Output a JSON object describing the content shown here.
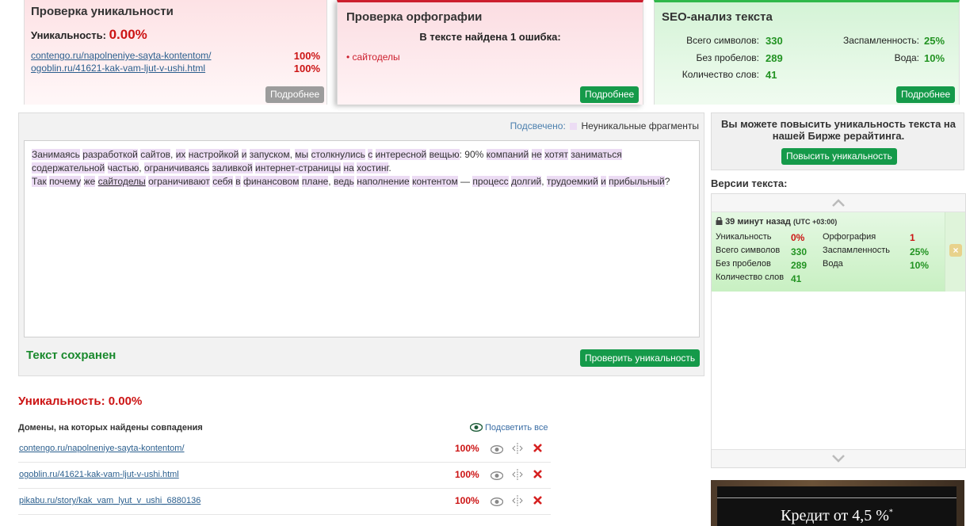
{
  "uniqueness_panel": {
    "title": "Проверка уникальности",
    "uniq_label": "Уникальность:",
    "uniq_value": "0.00%",
    "matches": [
      {
        "url": "contengo.ru/napolneniye-sayta-kontentom/",
        "pct": "100%"
      },
      {
        "url": "ogoblin.ru/41621-kak-vam-ljut-v-ushi.html",
        "pct": "100%"
      }
    ],
    "more_button": "Подробнее"
  },
  "spelling_panel": {
    "title": "Проверка орфографии",
    "summary": "В тексте найдена 1 ошибка:",
    "errors": [
      "сайтоделы"
    ],
    "more_button": "Подробнее"
  },
  "seo_panel": {
    "title": "SEO-анализ текста",
    "total_chars_label": "Всего символов:",
    "total_chars": "330",
    "no_spaces_label": "Без пробелов:",
    "no_spaces": "289",
    "word_count_label": "Количество слов:",
    "word_count": "41",
    "spam_label": "Заспамленность:",
    "spam": "25%",
    "water_label": "Вода:",
    "water": "10%",
    "more_button": "Подробнее"
  },
  "editor": {
    "highlight_label": "Подсвечено:",
    "legend_label": "Неуникальные фрагменты",
    "saved_status": "Текст сохранен",
    "check_button": "Проверить уникальность",
    "text_segments": [
      {
        "t": "Занимаясь",
        "h": true
      },
      {
        "t": " "
      },
      {
        "t": "разработкой",
        "h": true
      },
      {
        "t": " "
      },
      {
        "t": "сайтов",
        "h": true
      },
      {
        "t": ", "
      },
      {
        "t": "их",
        "h": true
      },
      {
        "t": " "
      },
      {
        "t": "настройкой",
        "h": true
      },
      {
        "t": " "
      },
      {
        "t": "и",
        "h": true
      },
      {
        "t": " "
      },
      {
        "t": "запуском",
        "h": true
      },
      {
        "t": ", "
      },
      {
        "t": "мы",
        "h": true
      },
      {
        "t": " "
      },
      {
        "t": "столкнулись",
        "h": true
      },
      {
        "t": " "
      },
      {
        "t": "с",
        "h": true
      },
      {
        "t": " "
      },
      {
        "t": "интересной",
        "h": true
      },
      {
        "t": " "
      },
      {
        "t": "вещью",
        "h": true
      },
      {
        "t": ": 90% "
      },
      {
        "t": "компаний",
        "h": true
      },
      {
        "t": " "
      },
      {
        "t": "не",
        "h": true
      },
      {
        "t": " "
      },
      {
        "t": "хотят",
        "h": true
      },
      {
        "t": " "
      },
      {
        "t": "заниматься",
        "h": true
      },
      {
        "t": "\n"
      },
      {
        "t": "содержательной",
        "h": true
      },
      {
        "t": " "
      },
      {
        "t": "частью",
        "h": true
      },
      {
        "t": ", "
      },
      {
        "t": "ограничиваясь",
        "h": true
      },
      {
        "t": " "
      },
      {
        "t": "заливкой",
        "h": true
      },
      {
        "t": " "
      },
      {
        "t": "интернет-страницы",
        "h": true
      },
      {
        "t": " "
      },
      {
        "t": "на",
        "h": true
      },
      {
        "t": " "
      },
      {
        "t": "хостинг",
        "h": true
      },
      {
        "t": "."
      },
      {
        "t": "\n"
      },
      {
        "t": "Так",
        "h": true
      },
      {
        "t": " "
      },
      {
        "t": "почему",
        "h": true
      },
      {
        "t": " "
      },
      {
        "t": "же",
        "h": true
      },
      {
        "t": " "
      },
      {
        "t": "сайтоделы",
        "h": true,
        "e": true
      },
      {
        "t": " "
      },
      {
        "t": "ограничивают",
        "h": true
      },
      {
        "t": " "
      },
      {
        "t": "себя",
        "h": true
      },
      {
        "t": " "
      },
      {
        "t": "в",
        "h": true
      },
      {
        "t": " "
      },
      {
        "t": "финансовом",
        "h": true
      },
      {
        "t": " "
      },
      {
        "t": "плане",
        "h": true
      },
      {
        "t": ", "
      },
      {
        "t": "ведь",
        "h": true
      },
      {
        "t": " "
      },
      {
        "t": "наполнение",
        "h": true
      },
      {
        "t": " "
      },
      {
        "t": "контентом",
        "h": true
      },
      {
        "t": " — "
      },
      {
        "t": "процесс",
        "h": true
      },
      {
        "t": " "
      },
      {
        "t": "долгий",
        "h": true
      },
      {
        "t": ", "
      },
      {
        "t": "трудоемкий",
        "h": true
      },
      {
        "t": " "
      },
      {
        "t": "и",
        "h": true
      },
      {
        "t": " "
      },
      {
        "t": "прибыльный",
        "h": true
      },
      {
        "t": "?"
      }
    ]
  },
  "results": {
    "uniq_label": "Уникальность:",
    "uniq_value": "0.00%",
    "domains_header": "Домены, на которых найдены совпадения",
    "highlight_all": "Подсветить все",
    "rows": [
      {
        "url": "contengo.ru/napolneniye-sayta-kontentom/",
        "pct": "100%"
      },
      {
        "url": "ogoblin.ru/41621-kak-vam-ljut-v-ushi.html",
        "pct": "100%"
      },
      {
        "url": "pikabu.ru/story/kak_vam_lyut_v_ushi_6880136",
        "pct": "100%"
      }
    ]
  },
  "promo": {
    "text": "Вы можете повысить уникальность текста на нашей Бирже рерайтинга.",
    "button": "Повысить уникальность"
  },
  "versions": {
    "title": "Версии текста:",
    "entry": {
      "time": "39 минут назад",
      "tz": "(UTC +03:00)",
      "uniq_label": "Уникальность",
      "uniq": "0%",
      "spell_label": "Орфография",
      "spell": "1",
      "total_label": "Всего символов",
      "total": "330",
      "spam_label": "Заспамленность",
      "spam": "25%",
      "nospace_label": "Без пробелов",
      "nospace": "289",
      "water_label": "Вода",
      "water": "10%",
      "words_label": "Количество слов",
      "words": "41"
    }
  },
  "ad": {
    "text": "Кредит от 4,5 %",
    "sup": "*"
  },
  "colors": {
    "accent_green": "#159a4a",
    "error_red": "#cc1414",
    "fragment_highlight": "#ecdcf4"
  }
}
